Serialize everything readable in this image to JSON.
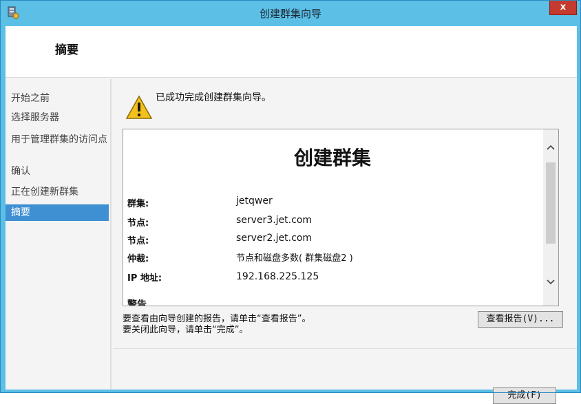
{
  "window": {
    "title": "创建群集向导",
    "close_label": "x"
  },
  "header": {
    "title": "摘要"
  },
  "sidebar": {
    "items": [
      {
        "label": "开始之前"
      },
      {
        "label": "选择服务器"
      },
      {
        "label": "用于管理群集的访问点"
      },
      {
        "label": "确认"
      },
      {
        "label": "正在创建新群集"
      },
      {
        "label": "摘要",
        "active": true
      }
    ]
  },
  "main": {
    "status_text": "已成功完成创建群集向导。",
    "report": {
      "title": "创建群集",
      "rows": [
        {
          "label": "群集:",
          "value": "jetqwer"
        },
        {
          "label": "节点:",
          "value": "server3.jet.com"
        },
        {
          "label": "节点:",
          "value": "server2.jet.com"
        },
        {
          "label": "仲裁:",
          "value": "节点和磁盘多数( 群集磁盘2 )"
        },
        {
          "label": "IP 地址:",
          "value": "192.168.225.125"
        }
      ],
      "cut_off_heading": "警告"
    },
    "info_line_1": "要查看由向导创建的报告，请单击“查看报告”。",
    "info_line_2": "要关闭此向导，请单击“完成”。",
    "view_report_button": "查看报告(V)...",
    "finish_button": "完成(F)"
  },
  "icons": {
    "title_icon": "cluster-wizard-icon",
    "status_icon": "warning-icon"
  }
}
